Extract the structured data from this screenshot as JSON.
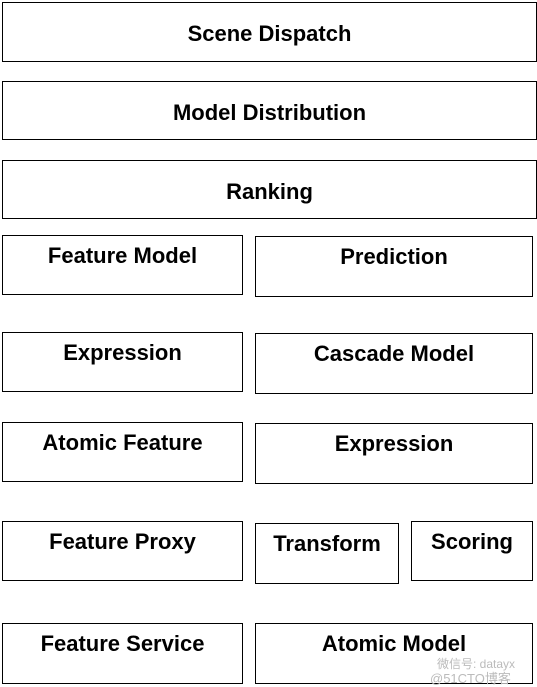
{
  "layers": {
    "scene_dispatch": "Scene Dispatch",
    "model_distribution": "Model Distribution",
    "ranking": "Ranking",
    "feature_model": "Feature Model",
    "prediction": "Prediction",
    "expression_left": "Expression",
    "cascade_model": "Cascade Model",
    "atomic_feature": "Atomic Feature",
    "expression_right": "Expression",
    "feature_proxy": "Feature Proxy",
    "transform": "Transform",
    "scoring": "Scoring",
    "feature_service": "Feature Service",
    "atomic_model": "Atomic Model"
  },
  "watermark": {
    "line1": "微信号: datayx",
    "line2": "@51CTO博客"
  }
}
